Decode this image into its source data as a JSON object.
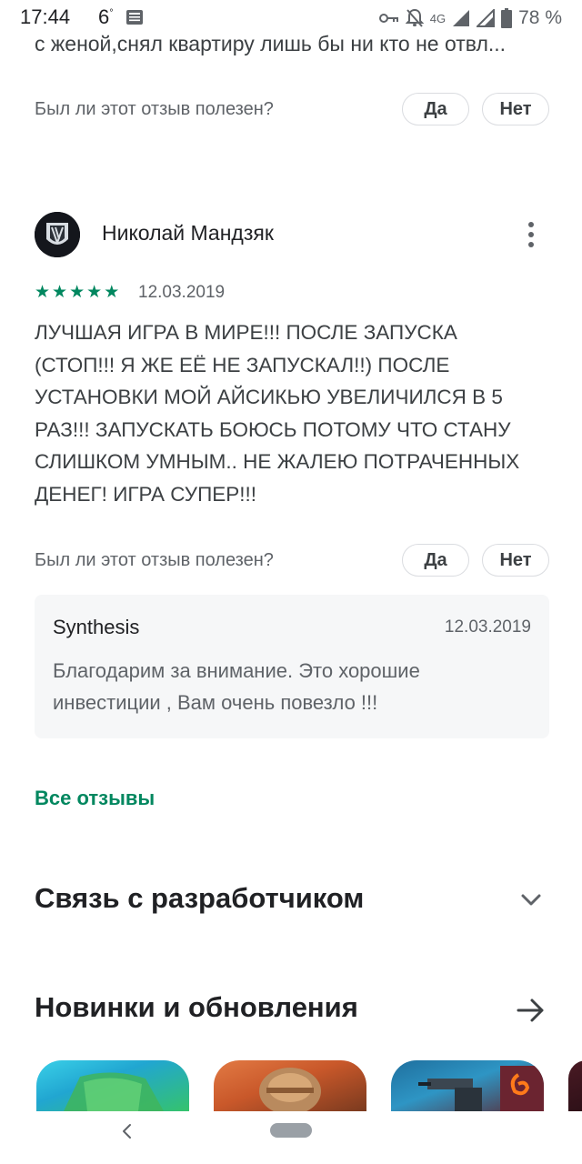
{
  "status_bar": {
    "time": "17:44",
    "temperature": "6",
    "network": "4G",
    "battery": "78 %"
  },
  "previous_review": {
    "truncated_text": "с женой,снял квартиру лишь бы ни кто не отвл..."
  },
  "helpful": {
    "question": "Был ли этот отзыв полезен?",
    "yes_label": "Да",
    "no_label": "Нет"
  },
  "review": {
    "author": "Николай Мандзяк",
    "rating": 5,
    "rating_max": 5,
    "date": "12.03.2019",
    "text": "ЛУЧШАЯ ИГРА В МИРЕ!!! ПОСЛЕ ЗАПУСКА (СТОП!!! Я ЖЕ ЕЁ НЕ ЗАПУСКАЛ!!) ПОСЛЕ УСТАНОВКИ МОЙ АЙСИКЬЮ УВЕЛИЧИЛСЯ В 5 РАЗ!!! ЗАПУСКАТЬ БОЮСЬ ПОТОМУ ЧТО СТАНУ СЛИШКОМ УМНЫМ.. НЕ ЖАЛЕЮ ПОТРАЧЕННЫХ ДЕНЕГ! ИГРА СУПЕР!!!"
  },
  "developer_reply": {
    "name": "Synthesis",
    "date": "12.03.2019",
    "text": "Благодарим за внимание. Это хорошие инвестиции , Вам очень повезло !!!"
  },
  "all_reviews_link": "Все отзывы",
  "sections": {
    "contact_developer": "Связь с разработчиком",
    "whats_new": "Новинки и обновления"
  },
  "colors": {
    "accent_green": "#01875f",
    "reply_background": "#f6f7f8"
  },
  "icons": {
    "star": "star-icon",
    "more": "more-vert-icon",
    "expand": "chevron-down-icon",
    "forward": "arrow-forward-icon"
  }
}
